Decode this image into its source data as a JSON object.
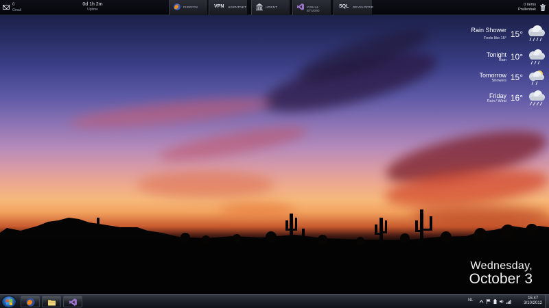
{
  "topbar": {
    "mail": {
      "count": "0",
      "label": "Gmail",
      "icon": "mail-icon"
    },
    "uptime": {
      "value": "0d 1h 2m",
      "label": "Uptime"
    },
    "launchers": [
      {
        "label": "FIREFOX",
        "icon": "firefox-icon"
      },
      {
        "prefix": "VPN",
        "label": "UGENTNET",
        "icon": "vpn-icon"
      },
      {
        "label": "UGENT",
        "icon": "university-building-icon"
      },
      {
        "label": "VISUAL STUDIO",
        "icon": "visual-studio-icon"
      },
      {
        "prefix": "SQL",
        "label": "DEVELOPER",
        "icon": "sql-icon"
      }
    ],
    "trash": {
      "count": "0 items",
      "label": "Prullenbak",
      "icon": "trash-icon"
    }
  },
  "weather": [
    {
      "condition": "Rain Shower",
      "detail": "Feels like 15°",
      "temp": "15°",
      "icon": "rain-cloud-icon"
    },
    {
      "condition": "Tonight",
      "detail": "Rain",
      "temp": "10°",
      "icon": "rain-cloud-icon"
    },
    {
      "condition": "Tomorrow",
      "detail": "Showers",
      "temp": "15°",
      "icon": "showers-cloud-icon"
    },
    {
      "condition": "Friday",
      "detail": "Rain / Wind",
      "temp": "16°",
      "icon": "rain-wind-cloud-icon"
    }
  ],
  "date": {
    "weekday": "Wednesday,",
    "month": "October",
    "day": "3"
  },
  "taskbar": {
    "start_icon": "windows-start-icon",
    "pinned": [
      {
        "name": "firefox",
        "icon": "firefox-icon"
      },
      {
        "name": "explorer",
        "icon": "folder-icon"
      },
      {
        "name": "visual-studio",
        "icon": "visual-studio-icon"
      }
    ],
    "tray": {
      "language": "NL",
      "icons": [
        "chevron-up-icon",
        "flag-icon",
        "power-icon",
        "volume-icon",
        "signal-icon"
      ],
      "time": "15:47",
      "date": "3/10/2012"
    }
  }
}
